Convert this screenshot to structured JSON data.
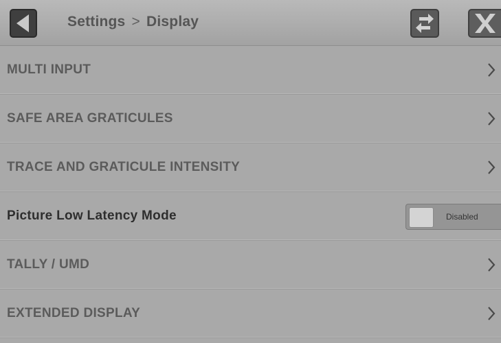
{
  "header": {
    "breadcrumb_parent": "Settings",
    "breadcrumb_separator": ">",
    "breadcrumb_current": "Display",
    "back_icon": "back-arrow-icon",
    "swap_icon": "swap-arrows-icon",
    "close_icon": "close-x-icon"
  },
  "menu": {
    "items": [
      {
        "label": "MULTI INPUT",
        "type": "submenu"
      },
      {
        "label": "SAFE AREA GRATICULES",
        "type": "submenu"
      },
      {
        "label": "TRACE AND GRATICULE INTENSITY",
        "type": "submenu"
      },
      {
        "label": "Picture Low Latency Mode",
        "type": "toggle",
        "state": "Disabled"
      },
      {
        "label": "TALLY / UMD",
        "type": "submenu"
      },
      {
        "label": "EXTENDED DISPLAY",
        "type": "submenu"
      }
    ]
  },
  "colors": {
    "background": "#a9a9a9",
    "button_dark": "#3f3f3f",
    "text": "#5b5b5b"
  }
}
